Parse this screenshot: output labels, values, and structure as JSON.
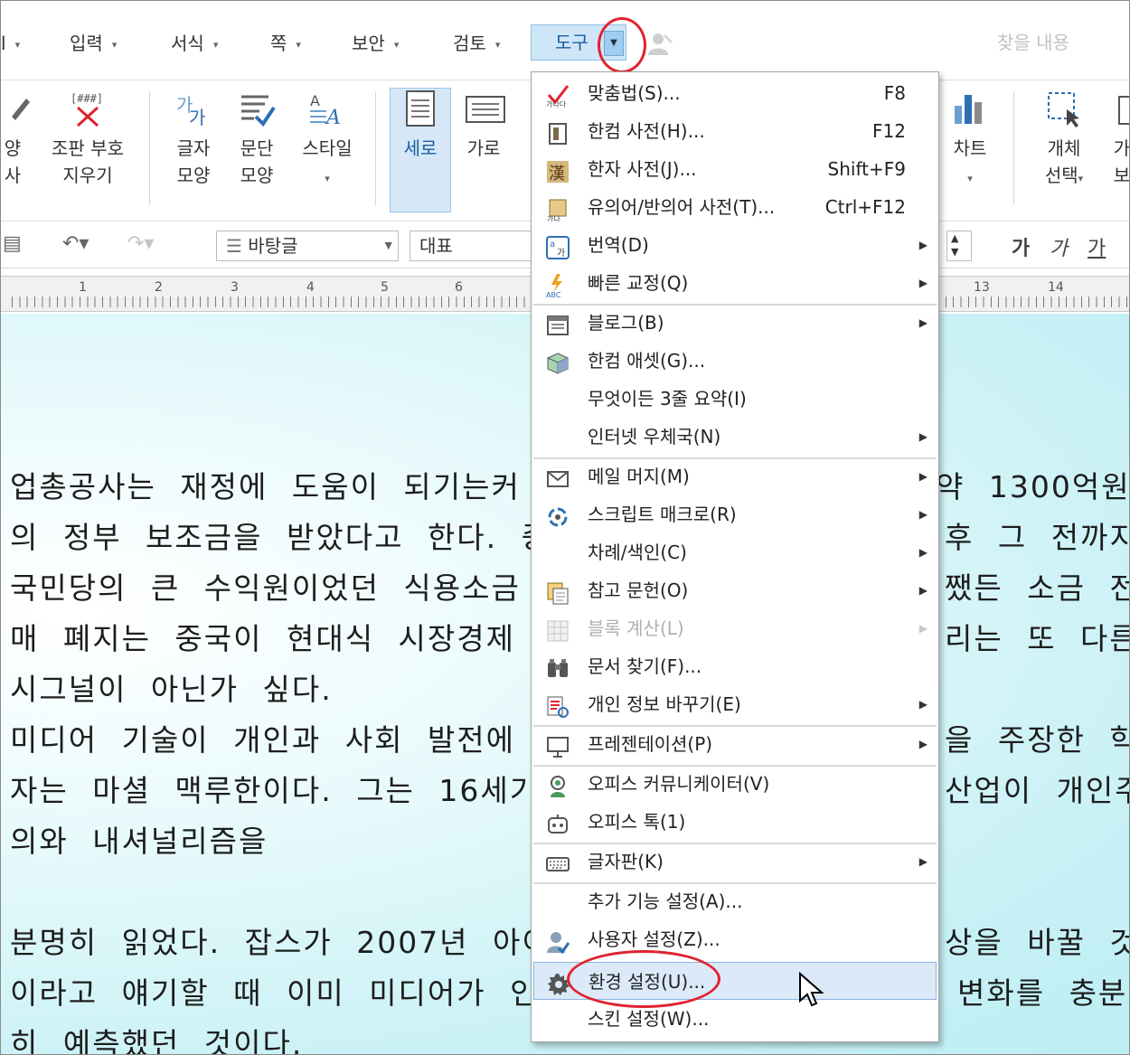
{
  "menubar": {
    "items": [
      "l",
      "입력",
      "서식",
      "쪽",
      "보안",
      "검토",
      "도구"
    ],
    "active_item": "도구",
    "search_placeholder": "찾을 내용"
  },
  "ribbon": {
    "partial_left": {
      "line1": "양",
      "line2": "사"
    },
    "clear_marks": {
      "line1": "조판 부호",
      "line2": "지우기"
    },
    "char_shape": {
      "line1": "글자",
      "line2": "모양"
    },
    "para_shape": {
      "line1": "문단",
      "line2": "모양"
    },
    "style": "스타일",
    "vertical": "세로",
    "horizontal": "가로",
    "chart": "차트",
    "object_select": {
      "line1": "개체",
      "line2": "선택"
    },
    "partial_right": {
      "line1": "가",
      "line2": "보"
    }
  },
  "format_toolbar": {
    "style_combo": "바탕글",
    "font_combo": "대표",
    "bold_label": "가",
    "italic_label": "가",
    "underline_label": "가"
  },
  "ruler": {
    "numbers_left": [
      "1",
      "2",
      "3",
      "4",
      "5",
      "6"
    ],
    "numbers_right": [
      "13",
      "14"
    ]
  },
  "document": {
    "lines": [
      "업총공사는 재정에 도움이 되기는커",
      "의 정부 보조금을 받았다고 한다. 중",
      "국민당의 큰 수익원이었던 식용소금",
      "매 폐지는 중국이 현대식 시장경제",
      "시그널이 아닌가 싶다.",
      "미디어 기술이 개인과 사회 발전에",
      "자는 마셜 맥루한이다. 그는 16세기",
      "의와 내셔널리즘을",
      "",
      "분명히 읽었다. 잡스가 2007년 아이",
      "이라고 얘기할 때 이미 미디어가 인",
      "히 예측했던 것이다."
    ],
    "right_lines": [
      "약 1300억원)",
      "후 그 전까지",
      "쨌든 소금 전",
      "리는 또 다른",
      "",
      "을 주장한 학",
      "산업이 개인주",
      "",
      "",
      "상을 바꿀 것",
      "변화를 충분"
    ]
  },
  "tools_menu": {
    "items": [
      {
        "label": "맞춤법(S)...",
        "shortcut": "F8",
        "icon": "spellcheck-icon",
        "submenu": false
      },
      {
        "label": "한컴 사전(H)...",
        "shortcut": "F12",
        "icon": "dictionary-icon",
        "submenu": false
      },
      {
        "label": "한자 사전(J)...",
        "shortcut": "Shift+F9",
        "icon": "hanja-dictionary-icon",
        "submenu": false
      },
      {
        "label": "유의어/반의어 사전(T)...",
        "shortcut": "Ctrl+F12",
        "icon": "thesaurus-icon",
        "submenu": false
      },
      {
        "label": "번역(D)",
        "shortcut": "",
        "icon": "translate-icon",
        "submenu": true
      },
      {
        "label": "빠른 교정(Q)",
        "shortcut": "",
        "icon": "quick-correct-icon",
        "submenu": true
      },
      {
        "label": "블로그(B)",
        "shortcut": "",
        "icon": "blog-icon",
        "submenu": true
      },
      {
        "label": "한컴 애셋(G)...",
        "shortcut": "",
        "icon": "asset-cube-icon",
        "submenu": false
      },
      {
        "label": "무엇이든 3줄 요약(I)",
        "shortcut": "",
        "icon": "",
        "submenu": false
      },
      {
        "label": "인터넷 우체국(N)",
        "shortcut": "",
        "icon": "",
        "submenu": true
      },
      {
        "label": "메일 머지(M)",
        "shortcut": "",
        "icon": "mail-icon",
        "submenu": true
      },
      {
        "label": "스크립트 매크로(R)",
        "shortcut": "",
        "icon": "macro-icon",
        "submenu": true
      },
      {
        "label": "차례/색인(C)",
        "shortcut": "",
        "icon": "",
        "submenu": true
      },
      {
        "label": "참고 문헌(O)",
        "shortcut": "",
        "icon": "bibliography-icon",
        "submenu": true
      },
      {
        "label": "블록 계산(L)",
        "shortcut": "",
        "icon": "block-calc-icon",
        "submenu": true,
        "disabled": true
      },
      {
        "label": "문서 찾기(F)...",
        "shortcut": "",
        "icon": "binoculars-icon",
        "submenu": false
      },
      {
        "label": "개인 정보 바꾸기(E)",
        "shortcut": "",
        "icon": "personal-info-icon",
        "submenu": true
      },
      {
        "label": "프레젠테이션(P)",
        "shortcut": "",
        "icon": "presentation-icon",
        "submenu": true
      },
      {
        "label": "오피스 커뮤니케이터(V)",
        "shortcut": "",
        "icon": "communicator-icon",
        "submenu": false
      },
      {
        "label": "오피스 톡(1)",
        "shortcut": "",
        "icon": "office-talk-icon",
        "submenu": false
      },
      {
        "label": "글자판(K)",
        "shortcut": "",
        "icon": "keyboard-icon",
        "submenu": true
      },
      {
        "label": "추가 기능 설정(A)...",
        "shortcut": "",
        "icon": "",
        "submenu": false
      },
      {
        "label": "사용자 설정(Z)...",
        "shortcut": "",
        "icon": "user-settings-icon",
        "submenu": false
      },
      {
        "label": "환경 설정(U)...",
        "shortcut": "",
        "icon": "gear-icon",
        "submenu": false,
        "highlighted": true
      },
      {
        "label": "스킨 설정(W)...",
        "shortcut": "",
        "icon": "",
        "submenu": false
      }
    ]
  },
  "colors": {
    "annotation_red": "#e0232e",
    "active_menu_bg": "#cfe6f8",
    "highlight_bg": "#dbe9f9",
    "doc_bg": "#c9f1f6"
  }
}
